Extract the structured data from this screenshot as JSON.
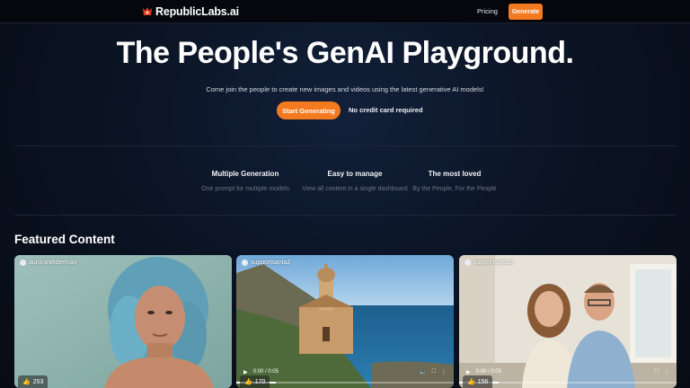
{
  "header": {
    "logo_text": "RepublicLabs.ai",
    "nav_pricing": "Pricing",
    "generate_label": "Generate",
    "accent_color": "#f47a20"
  },
  "hero": {
    "title": "The People's GenAI Playground.",
    "subtitle": "Come join the people to create new images and videos using the latest generative AI models!",
    "cta_label": "Start Generating",
    "no_card_text": "No credit card required"
  },
  "features": [
    {
      "title": "Multiple Generation",
      "desc": "One prompt for multiple models"
    },
    {
      "title": "Easy to manage",
      "desc": "View all content in a single dashboard"
    },
    {
      "title": "The most loved",
      "desc": "By the People, For the People"
    }
  ],
  "featured": {
    "heading": "Featured Content",
    "cards": [
      {
        "user": "aurorahelderman",
        "likes": "253",
        "type": "image"
      },
      {
        "user": "supportsanta2",
        "likes": "170",
        "type": "video",
        "time": "0:00 / 0:05"
      },
      {
        "user": "supportsanta2",
        "likes": "156",
        "type": "video",
        "time": "0:00 / 0:05"
      }
    ]
  }
}
